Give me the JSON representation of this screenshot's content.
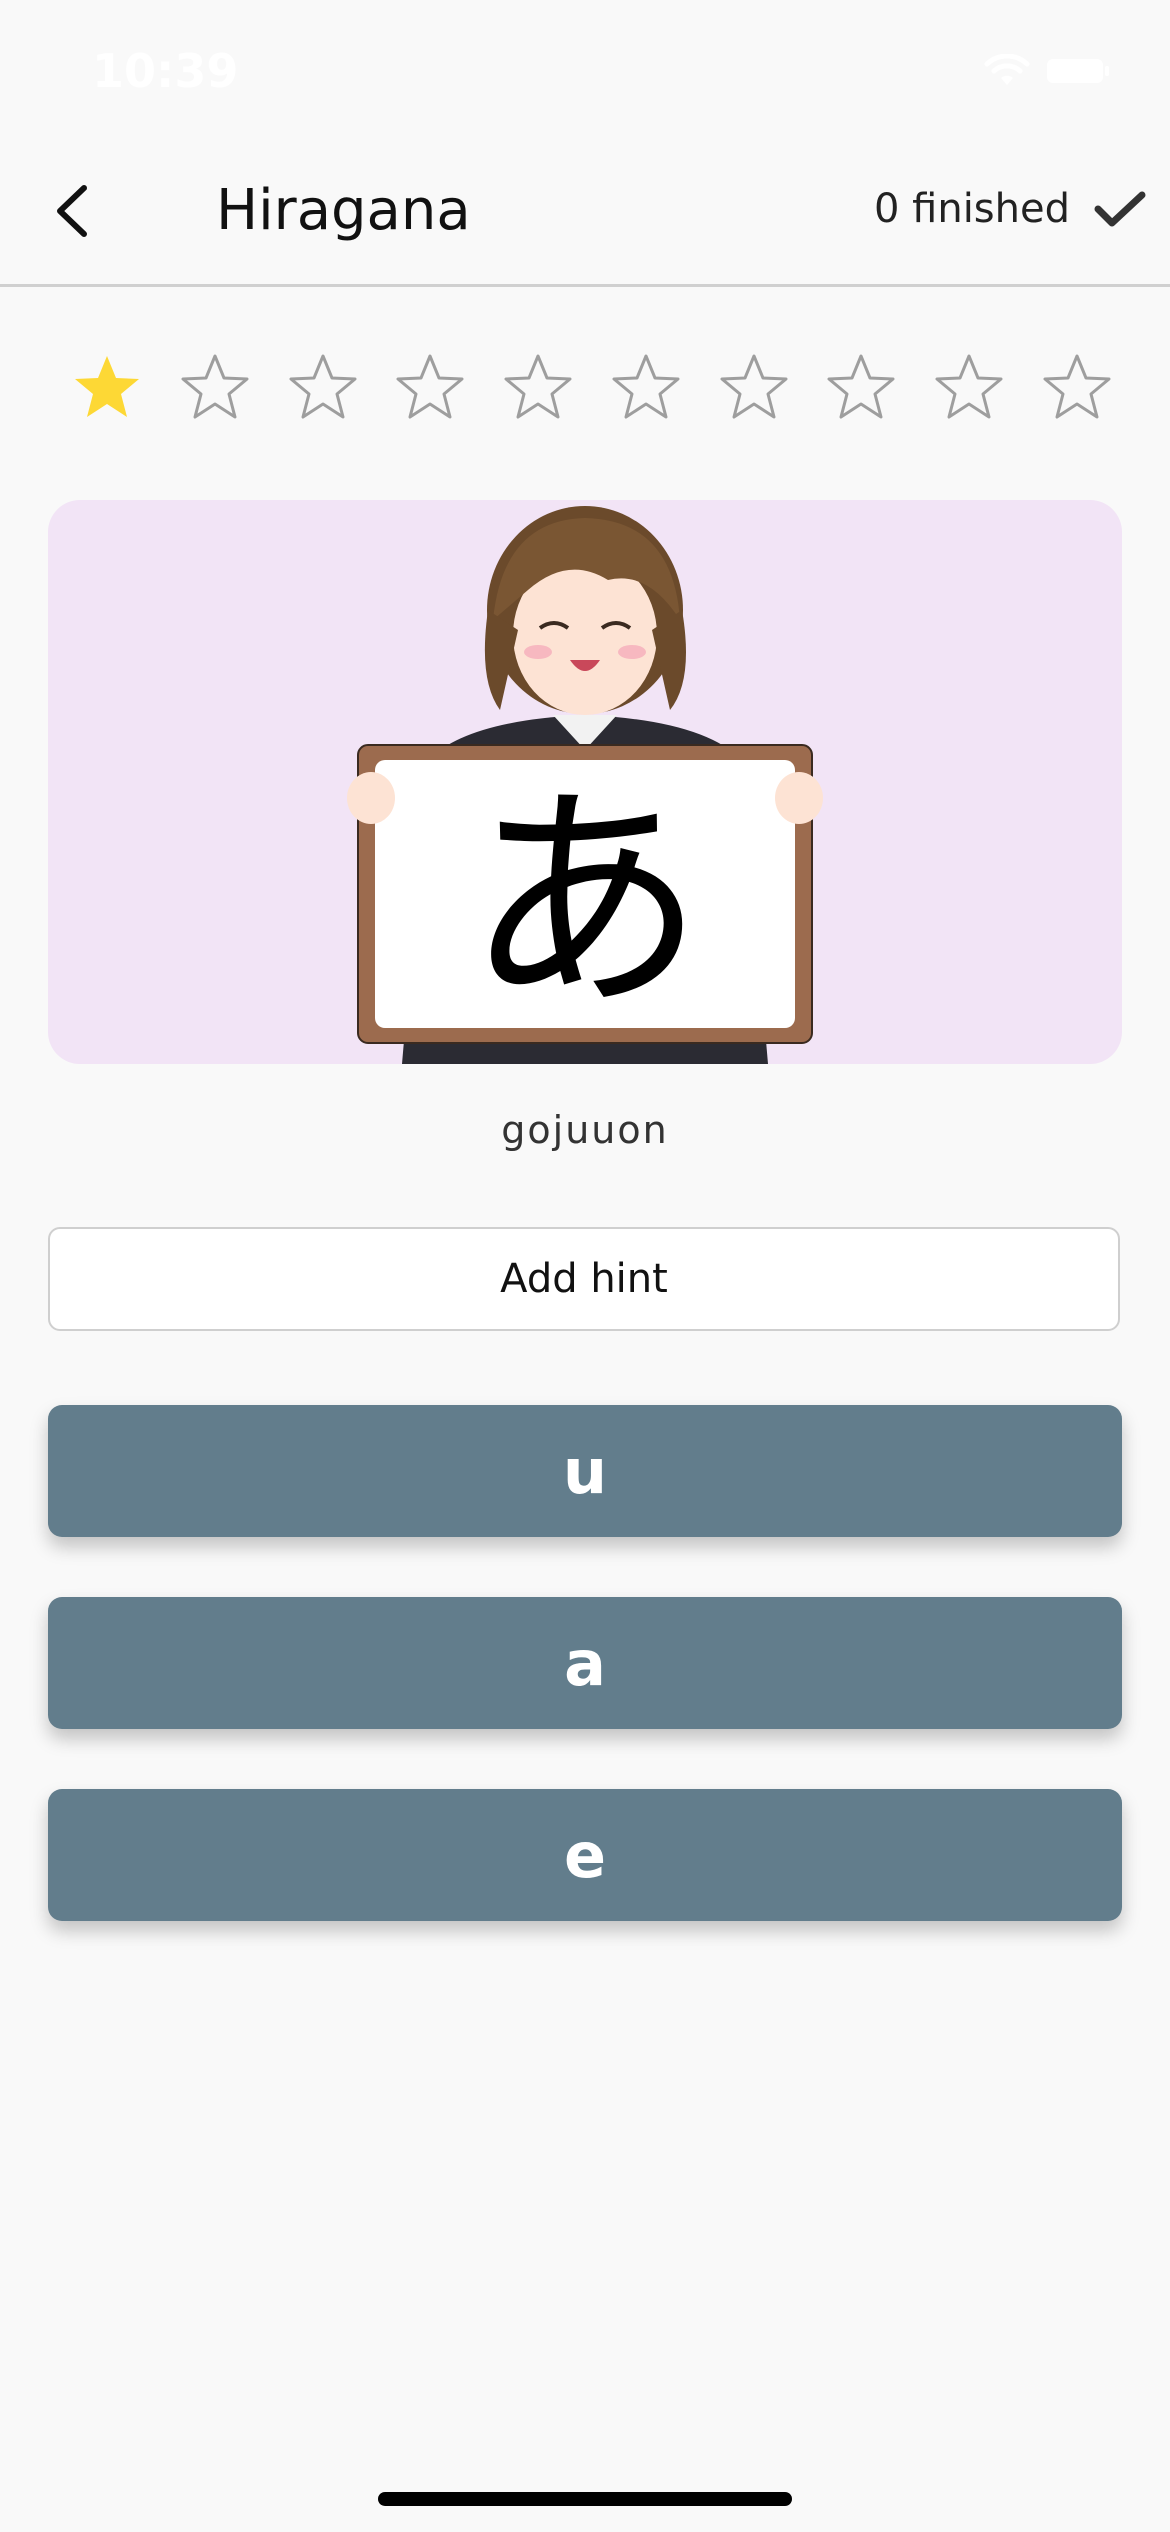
{
  "status_bar": {
    "time": "10:39"
  },
  "header": {
    "title": "Hiragana",
    "finished_label": "0 finished"
  },
  "rating": {
    "filled": 1,
    "total": 10,
    "filled_color": "#fdd835",
    "empty_color": "#9e9e9e"
  },
  "card": {
    "character": "あ",
    "background_color": "#f2e4f6",
    "category": "gojuuon"
  },
  "hint_button": {
    "label": "Add hint"
  },
  "answers": [
    {
      "label": "u"
    },
    {
      "label": "a"
    },
    {
      "label": "e"
    }
  ],
  "colors": {
    "answer_button": "#627d8c",
    "background": "#f9f9f9"
  }
}
